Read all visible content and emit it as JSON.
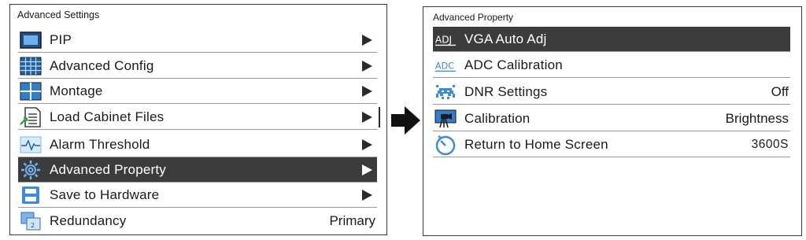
{
  "left_panel": {
    "title": "Advanced Settings",
    "items": [
      {
        "label": "PIP",
        "icon": "pip-icon"
      },
      {
        "label": "Advanced Config",
        "icon": "grid-icon"
      },
      {
        "label": "Montage",
        "icon": "montage-icon"
      },
      {
        "label": "Load Cabinet Files",
        "icon": "load-file-icon"
      },
      {
        "label": "Alarm Threshold",
        "icon": "alarm-wave-icon"
      },
      {
        "label": "Advanced Property",
        "icon": "gear-icon",
        "selected": true
      },
      {
        "label": "Save  to Hardware",
        "icon": "save-icon"
      },
      {
        "label": "Redundancy",
        "icon": "redundancy-icon",
        "value": "Primary"
      }
    ]
  },
  "right_panel": {
    "title": "Advanced Property",
    "items": [
      {
        "label": "VGA Auto Adj",
        "icon": "adj-icon",
        "icon_text": "ADJ",
        "selected": true
      },
      {
        "label": "ADC Calibration",
        "icon": "adc-icon",
        "icon_text": "ADC"
      },
      {
        "label": "DNR Settings",
        "icon": "dnr-icon",
        "value": "Off"
      },
      {
        "label": "Calibration",
        "icon": "calibration-icon",
        "value": "Brightness"
      },
      {
        "label": "Return to Home Screen",
        "icon": "timer-icon",
        "value": "3600S"
      }
    ]
  },
  "colors": {
    "selected_bg": "#3c3c3c",
    "icon_blue": "#2f7fd0",
    "border": "#3a3a3a"
  }
}
